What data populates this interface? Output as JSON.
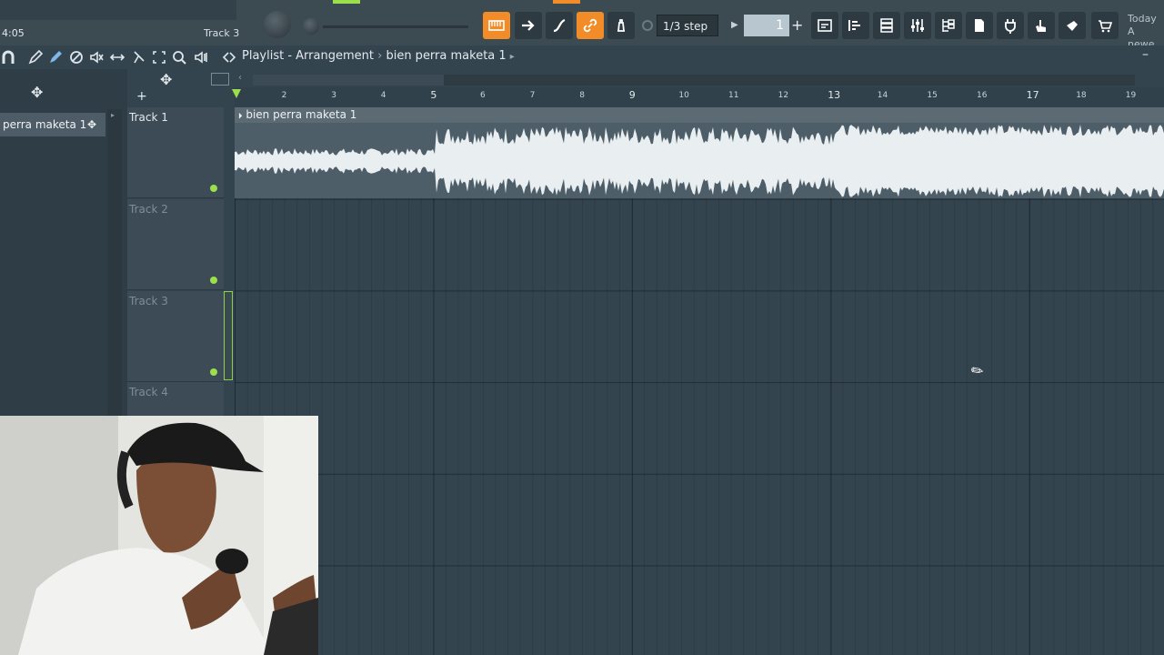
{
  "window": {
    "time": "4:05",
    "hint_label": "Track 3",
    "snap_label": "1/3 step",
    "pattern_number": "1",
    "news_line1": "Today",
    "news_line2": "A newe..."
  },
  "playlist": {
    "title": "Playlist - Arrangement",
    "separator": "›",
    "pattern": "bien perra maketa 1",
    "pattern_short": "perra maketa 1"
  },
  "ruler": {
    "bars": [
      "2",
      "3",
      "4",
      "5",
      "6",
      "7",
      "8",
      "9",
      "10",
      "11",
      "12",
      "13",
      "14",
      "15",
      "16",
      "17",
      "18",
      "19"
    ],
    "major_bars": [
      "5",
      "9",
      "13",
      "17"
    ]
  },
  "tracks": [
    {
      "name": "Track 1"
    },
    {
      "name": "Track 2"
    },
    {
      "name": "Track 3"
    },
    {
      "name": "Track 4"
    }
  ],
  "clip": {
    "label": "bien perra maketa 1",
    "color": "#4e5e68",
    "wave_color": "#e9eef1"
  },
  "colors": {
    "accent": "#f28c28",
    "track_led": "#9be04a",
    "background": "#34444f"
  },
  "icons": [
    "magnet-icon",
    "pencil-icon",
    "paint-icon",
    "delete-icon",
    "mute-icon",
    "slip-icon",
    "select-icon",
    "zoom-icon",
    "playback-icon",
    "arrow-icon",
    "curve-icon",
    "link-icon",
    "stamp-icon",
    "mixer-icon",
    "channel-rack-icon",
    "piano-roll-icon",
    "browser-icon",
    "plugin-icon",
    "shop-icon"
  ]
}
